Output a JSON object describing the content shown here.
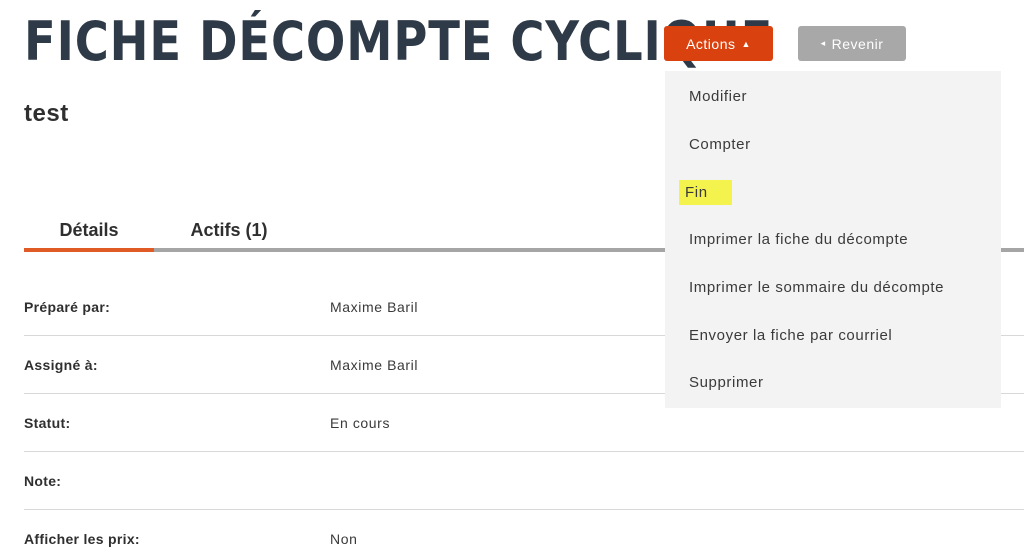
{
  "header": {
    "title": "FICHE DÉCOMPTE CYCLIQUE",
    "subtitle": "test"
  },
  "toolbar": {
    "actions_label": "Actions",
    "actions_caret": "▲",
    "back_label": "Revenir",
    "back_arrow": "◂"
  },
  "tabs": [
    {
      "label": "Détails",
      "active": true
    },
    {
      "label": "Actifs (1)",
      "active": false
    }
  ],
  "details": [
    {
      "label": "Préparé par:",
      "value": "Maxime Baril"
    },
    {
      "label": "Assigné à:",
      "value": "Maxime Baril"
    },
    {
      "label": "Statut:",
      "value": "En cours"
    },
    {
      "label": "Note:",
      "value": ""
    },
    {
      "label": "Afficher les prix:",
      "value": "Non"
    }
  ],
  "actions_menu": {
    "items": [
      {
        "label": "Modifier"
      },
      {
        "label": "Compter"
      },
      {
        "label": "Fin",
        "highlighted": true
      },
      {
        "label": "Imprimer la fiche du décompte"
      },
      {
        "label": "Imprimer le sommaire du décompte"
      },
      {
        "label": "Envoyer la fiche par courriel"
      },
      {
        "label": "Supprimer"
      }
    ]
  },
  "colors": {
    "title": "#2e3a47",
    "actions_button": "#d9410f",
    "back_button": "#a8a8a8",
    "tab_active_underline": "#e05a25",
    "menu_bg": "#f3f3f3",
    "highlight": "#f4f24d"
  }
}
